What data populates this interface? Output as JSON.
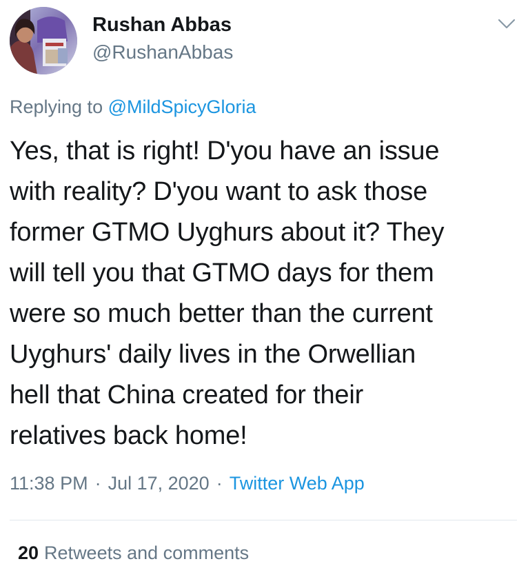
{
  "author": {
    "display_name": "Rushan Abbas",
    "handle": "@RushanAbbas",
    "avatar_icon": "profile-photo"
  },
  "menu": {
    "icon": "chevron-down-icon"
  },
  "reply": {
    "prefix": "Replying to",
    "mention": "@MildSpicyGloria"
  },
  "tweet": {
    "lines": [
      "Yes, that is right! D'you have an issue",
      "with reality? D'you want to ask those",
      "former GTMO Uyghurs about it? They",
      "will tell you that GTMO days for them",
      "were so much better than the current",
      "Uyghurs' daily lives in the Orwellian",
      "hell that China created for their",
      "relatives back home!"
    ]
  },
  "meta": {
    "time": "11:38 PM",
    "date": "Jul 17, 2020",
    "separator": "·",
    "source": "Twitter Web App"
  },
  "stats": {
    "count": "20",
    "label": "Retweets and comments"
  },
  "colors": {
    "text": "#14171a",
    "secondary": "#657786",
    "link": "#1b95e0",
    "divider": "#e1e8ed"
  }
}
